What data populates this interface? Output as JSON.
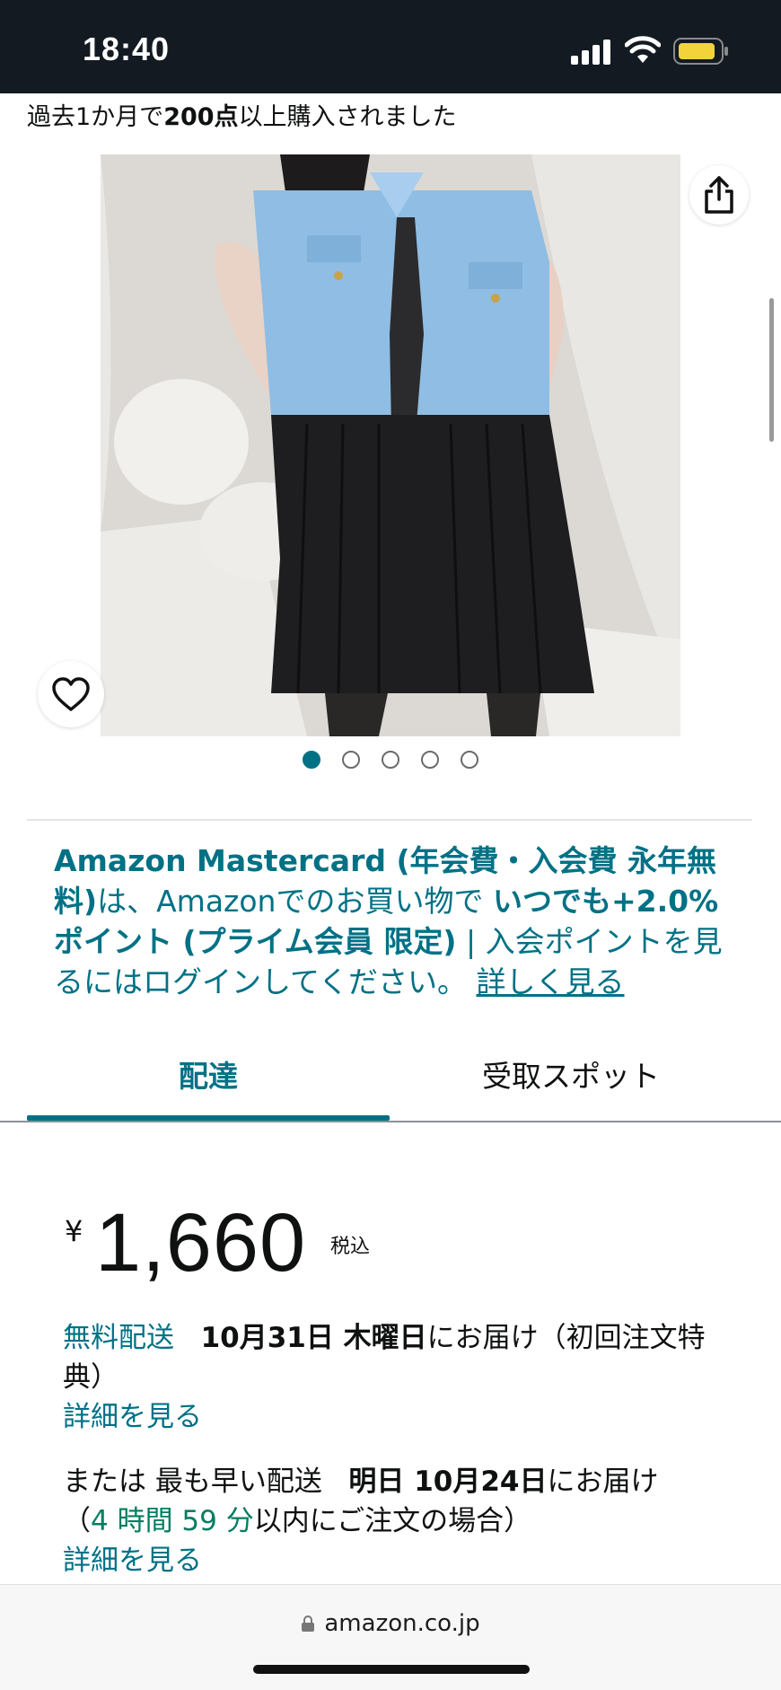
{
  "status_bar": {
    "time": "18:40"
  },
  "bought_notice": {
    "prefix": "過去1か月で",
    "count": "200点",
    "suffix": "以上購入されました"
  },
  "gallery": {
    "image_count": 5,
    "active_index": 0
  },
  "promo": {
    "bold1": "Amazon Mastercard (年会費・入会費 永年無料)",
    "text1": "は、Amazonでのお買い物で ",
    "bold2": "いつでも+2.0%ポイント (プライム会員 限定)",
    "text2": " | 入会ポイントを見るにはログインしてください。 ",
    "link": "詳しく見る"
  },
  "tabs": [
    {
      "label": "配達",
      "active": true
    },
    {
      "label": "受取スポット",
      "active": false
    }
  ],
  "price": {
    "currency": "¥",
    "amount": "1,660",
    "tax_label": "税込"
  },
  "shipping_free": {
    "label": "無料配送",
    "date": "10月31日 木曜日",
    "text": "にお届け（初回注文特典）",
    "details_link": "詳細を見る"
  },
  "shipping_fast": {
    "prefix": "または 最も早い配送",
    "date": "明日 10月24日",
    "text": "にお届け",
    "paren_open": "（",
    "countdown": "4 時間 59 分",
    "paren_text": "以内にご注文の場合）",
    "details_link": "詳細を見る"
  },
  "browser": {
    "url": "amazon.co.jp"
  },
  "colors": {
    "link": "#007185",
    "status_bar": "#131a22",
    "countdown": "#067d62",
    "battery": "#f2d33b"
  }
}
